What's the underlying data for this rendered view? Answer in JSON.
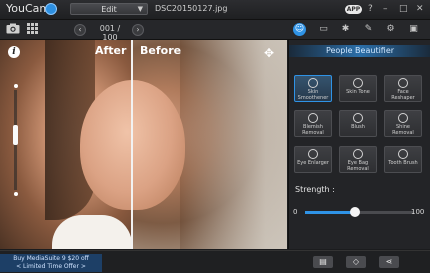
{
  "titlebar": {
    "app_name": "YouCam",
    "mode": "Edit",
    "file_name": "DSC20150127.jpg",
    "app_badge": "APP",
    "help": "?",
    "minimize": "–",
    "maximize": "□",
    "close": "✕"
  },
  "toolbar": {
    "page_counter": "001 / 100",
    "prev": "‹",
    "next": "›"
  },
  "photo": {
    "label_after": "After",
    "label_before": "Before",
    "info": "i"
  },
  "panel": {
    "header": "People Beautifier",
    "features": [
      {
        "label": "Skin Smoothener",
        "selected": true
      },
      {
        "label": "Skin Tone",
        "selected": false
      },
      {
        "label": "Face Reshaper",
        "selected": false
      },
      {
        "label": "Blemish Removal",
        "selected": false
      },
      {
        "label": "Blush",
        "selected": false
      },
      {
        "label": "Shine Removal",
        "selected": false
      },
      {
        "label": "Eye Enlarger",
        "selected": false
      },
      {
        "label": "Eye Bag Removal",
        "selected": false
      },
      {
        "label": "Tooth Brush",
        "selected": false
      }
    ],
    "strength": {
      "label": "Strength :",
      "min": "0",
      "max": "100",
      "value": 46
    }
  },
  "status": {
    "promo_line1": "Buy  MediaSuite 9 $20 off",
    "promo_line2": "< Limited Time Offer >"
  },
  "colors": {
    "accent": "#2f93e6",
    "background": "#1b1c1e"
  }
}
